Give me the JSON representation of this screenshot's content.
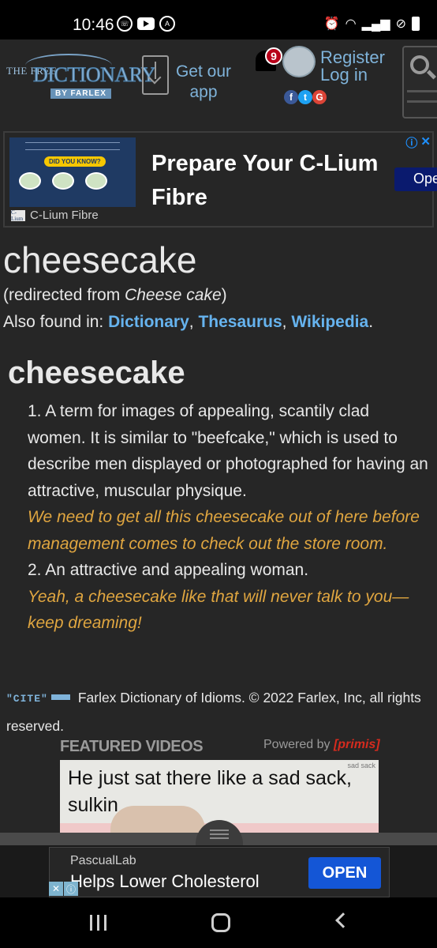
{
  "status_bar": {
    "time": "10:46",
    "left_icons": [
      "whatsapp-icon",
      "youtube-icon",
      "translate-icon"
    ],
    "right_icons": [
      "alarm-icon",
      "wifi-icon",
      "signal-icon",
      "dnd-icon",
      "battery-icon"
    ]
  },
  "header": {
    "logo_top": "THE FREE",
    "logo_main": "DICTIONARY",
    "logo_sub": "BY FARLEX",
    "get_app": "Get our app",
    "notification_count": "9",
    "register": "Register",
    "login": "Log in",
    "socials": [
      "f",
      "t",
      "G"
    ]
  },
  "ad_banner": {
    "image_badge": "DID YOU KNOW?",
    "brand": "C-Lium Fibre",
    "brand_mini": "C-Lium",
    "title": "Prepare Your C-Lium Fibre",
    "open": "Ope",
    "info": "ⓘ",
    "close": "✕"
  },
  "entry": {
    "title": "cheesecake",
    "redirect_prefix": "(redirected from ",
    "redirect_term": "Cheese cake",
    "redirect_suffix": ")",
    "found_in_label": "Also found in: ",
    "found_in": [
      "Dictionary",
      "Thesaurus",
      "Wikipedia"
    ],
    "sep1": ", ",
    "sep2": ", ",
    "end": "."
  },
  "definition": {
    "headword": "cheesecake",
    "senses": [
      {
        "text": "1. A term for images of appealing, scantily clad women. It is similar to \"beefcake,\" which is used to describe men displayed or photographed for having an attractive, muscular physique.",
        "example": "We need to get all this cheesecake out of here before management comes to check out the store room."
      },
      {
        "text": "2. An attractive and appealing woman.",
        "example": "Yeah, a cheesecake like that will never talk to you—keep dreaming!"
      }
    ]
  },
  "citation": {
    "badge": "\"CITE\"",
    "text": "Farlex Dictionary of Idioms. © 2022 Farlex, Inc, all rights reserved."
  },
  "featured": {
    "label": "FEATURED VIDEOS",
    "powered_by": "Powered by ",
    "provider": "[primis]",
    "video_caption": "He just sat there like a sad sack, sulkin",
    "video_corner": "sad sack"
  },
  "bottom_ad": {
    "advertiser": "PascualLab",
    "headline": "Helps Lower Cholesterol",
    "open": "OPEN",
    "close": "✕",
    "info": "ⓘ"
  }
}
